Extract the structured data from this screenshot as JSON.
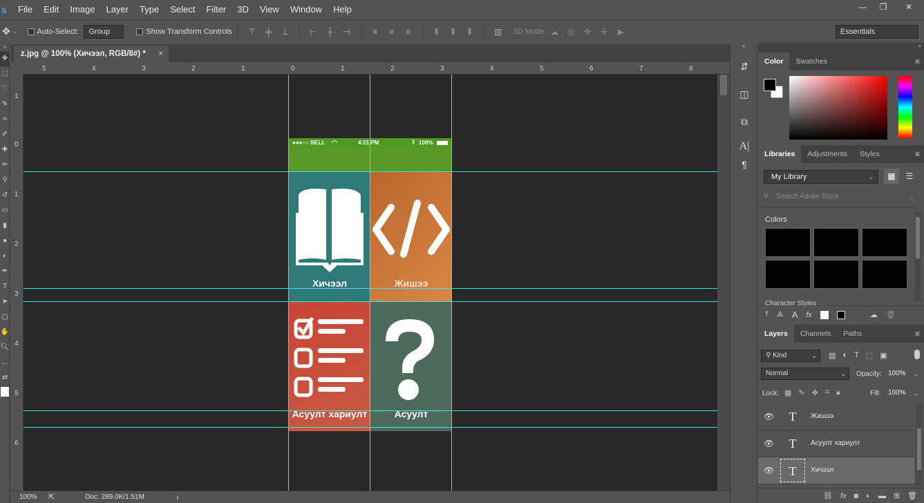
{
  "app": {
    "logo": "s"
  },
  "menu": [
    "File",
    "Edit",
    "Image",
    "Layer",
    "Type",
    "Select",
    "Filter",
    "3D",
    "View",
    "Window",
    "Help"
  ],
  "window_controls": {
    "minimize": "—",
    "restore": "❐",
    "close": "✕"
  },
  "options": {
    "auto_select_label": "Auto-Select:",
    "auto_select_value": "Group",
    "transform_label": "Show Transform Controls",
    "mode3d_label": "3D Mode:",
    "workspace": "Essentials"
  },
  "document": {
    "tab_title": "z.jpg @ 100% (Хичээл, RGB/8#) *",
    "close": "×",
    "zoom": "100%",
    "doc_info": "Doc: 289.0K/1.51M"
  },
  "ruler_h_labels": [
    "5",
    "4",
    "3",
    "2",
    "1",
    "0",
    "1",
    "2",
    "3",
    "4",
    "5",
    "6",
    "7",
    "8"
  ],
  "ruler_v_labels": [
    "1",
    "0",
    "1",
    "2",
    "3",
    "4",
    "5",
    "6"
  ],
  "phone": {
    "carrier": "●●●○○ BELL",
    "time": "4:21 PM",
    "battery": "100%",
    "tiles": [
      {
        "label": "Хичээл",
        "color": "#2f7a78"
      },
      {
        "label": "Жишээ",
        "color": "#c9793a"
      },
      {
        "label": "Асуулт хариулт",
        "color": "#c84a3a"
      },
      {
        "label": "Асуулт",
        "color": "#4e6a5c"
      }
    ]
  },
  "color_panel": {
    "tabs": [
      "Color",
      "Swatches"
    ]
  },
  "libraries_panel": {
    "tabs": [
      "Libraries",
      "Adjustments",
      "Styles"
    ],
    "library": "My Library",
    "search_placeholder": "Search Adobe Stock",
    "colors_heading": "Colors",
    "char_styles_heading": "Character Styles"
  },
  "layers_panel": {
    "tabs": [
      "Layers",
      "Channels",
      "Paths"
    ],
    "kind": "Kind",
    "blend_mode": "Normal",
    "opacity_label": "Opacity:",
    "opacity_value": "100%",
    "lock_label": "Lock:",
    "fill_label": "Fill:",
    "fill_value": "100%",
    "layers": [
      "Жишээ",
      "Асуулт хариулт",
      "Хичээл"
    ],
    "layer_icon": "T"
  }
}
